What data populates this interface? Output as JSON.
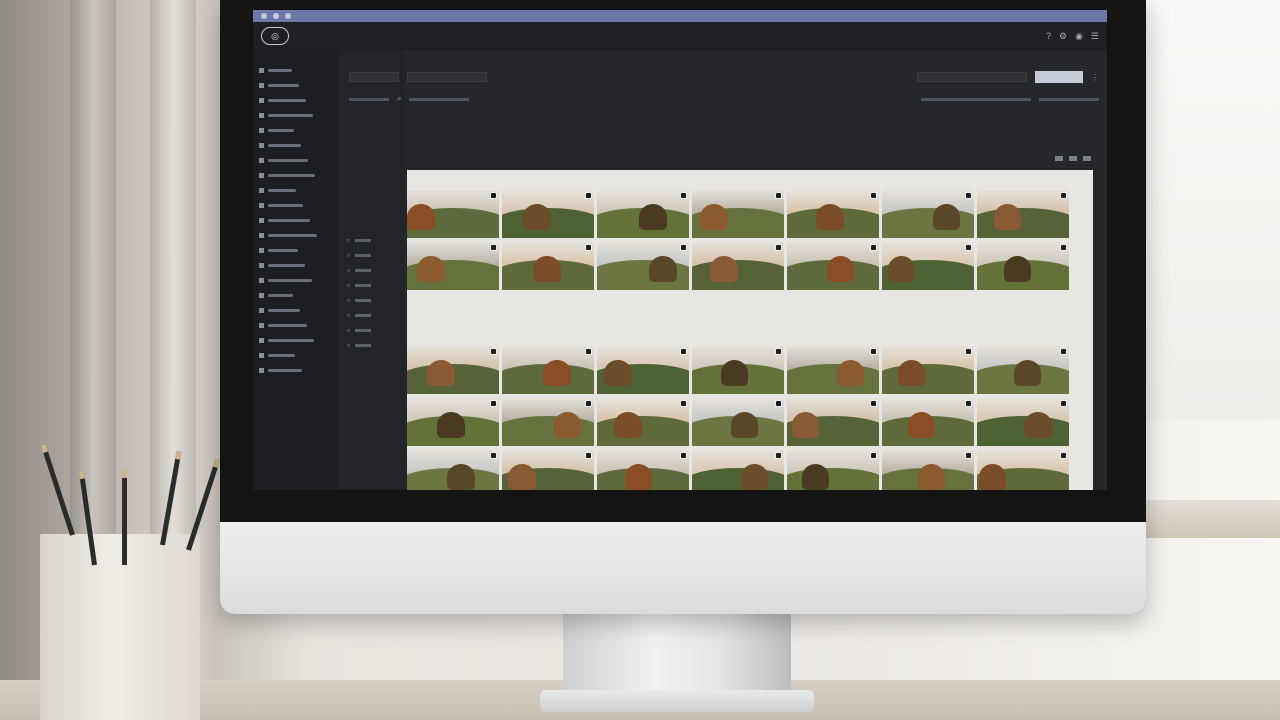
{
  "app": {
    "title": "",
    "heading": "",
    "section_title": ""
  },
  "sidebar": {
    "items": [
      "",
      "",
      "",
      "",
      "",
      "",
      "",
      "",
      "",
      "",
      "",
      "",
      "",
      "",
      "",
      "",
      "",
      "",
      "",
      "",
      ""
    ]
  },
  "secondary_panel": {
    "items": [
      "",
      "",
      "",
      "",
      "",
      "",
      "",
      ""
    ]
  },
  "toolbar": {
    "search_placeholder": ""
  },
  "grid": {
    "palettes": [
      {
        "sky": "#c8c1b4",
        "hill": "#5d6a3b",
        "tree": "#8a4e26"
      },
      {
        "sky": "#d8c6b0",
        "hill": "#4f6236",
        "tree": "#6b4d2a"
      },
      {
        "sky": "#cfc6bb",
        "hill": "#627238",
        "tree": "#4b3a22"
      },
      {
        "sky": "#b6b0a3",
        "hill": "#65723e",
        "tree": "#8c5a2f"
      },
      {
        "sky": "#d9c4a8",
        "hill": "#5e6a3a",
        "tree": "#7a4c2a"
      },
      {
        "sky": "#c6c6c4",
        "hill": "#6d7642",
        "tree": "#5a4628"
      },
      {
        "sky": "#d2c1a8",
        "hill": "#566238",
        "tree": "#8a5a34"
      }
    ],
    "rows": 5,
    "cols": 7
  }
}
